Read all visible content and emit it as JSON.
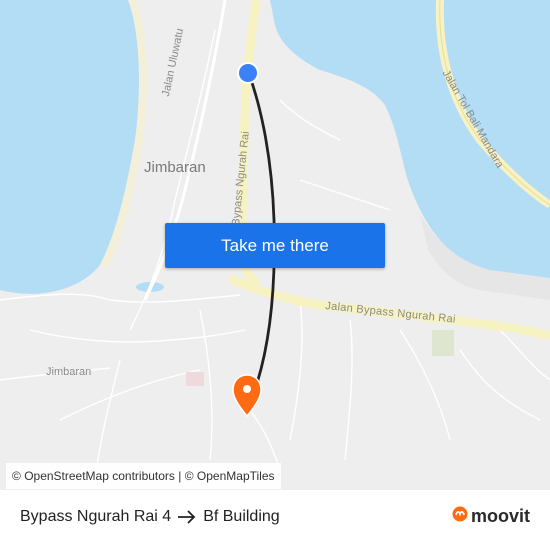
{
  "map": {
    "labels": {
      "road_uluwatu": "Jalan Uluwatu",
      "road_bypass_vertical": "Bypass Ngurah Rai",
      "road_tol": "Jalan Tol Bali Mandara",
      "road_bypass_horizontal": "Jalan Bypass Ngurah Rai",
      "area_jimbaran_large": "Jimbaran",
      "area_jimbaran_small": "Jimbaran"
    },
    "colors": {
      "water": "#b3dcf5",
      "land": "#eeeeee",
      "road_major": "#f7f2c2",
      "route_line": "#222222",
      "origin_marker": "#3b82f6",
      "destination_marker": "#ff6a13"
    },
    "origin_marker": "origin-dot-icon",
    "destination_marker": "location-pin-icon"
  },
  "cta": {
    "label": "Take me there"
  },
  "attribution": {
    "prefix": "©",
    "osm_contributors": "OpenStreetMap contributors",
    "separator": "| ©",
    "openmaptiles": "OpenMapTiles"
  },
  "footer": {
    "origin": "Bypass Ngurah Rai 4",
    "arrow_icon": "arrow-right-icon",
    "destination": "Bf Building",
    "brand": "moovit",
    "brand_icon": "moovit-logo-icon",
    "brand_color": "#ff6a13"
  }
}
